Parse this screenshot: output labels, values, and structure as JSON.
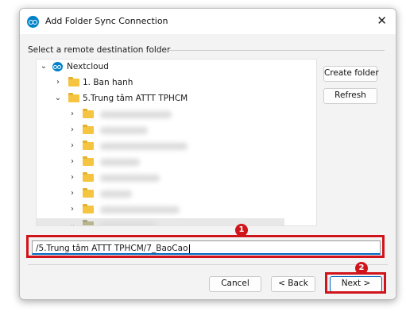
{
  "window": {
    "title": "Add Folder Sync Connection",
    "close_icon": "close-icon"
  },
  "group_label": "Select a remote destination folder",
  "tree": {
    "root": {
      "label": "Nextcloud",
      "icon": "nextcloud-icon",
      "expanded": true
    },
    "items": [
      {
        "label": "1. Ban hanh",
        "expanded": false
      },
      {
        "label": "5.Trung tâm ATTT TPHCM",
        "expanded": true
      }
    ],
    "redacted_children": 7
  },
  "side_buttons": {
    "create_folder": "Create folder",
    "refresh": "Refresh"
  },
  "path_input": {
    "value": "/5.Trung tâm ATTT TPHCM/7_BaoCao"
  },
  "footer": {
    "cancel": "Cancel",
    "back": "< Back",
    "next": "Next >"
  },
  "annotations": {
    "step1": "1",
    "step2": "2",
    "color": "#d0141b"
  },
  "colors": {
    "accent": "#0067c0",
    "nextcloud_blue": "#0082c9",
    "folder": "#f5c542"
  }
}
